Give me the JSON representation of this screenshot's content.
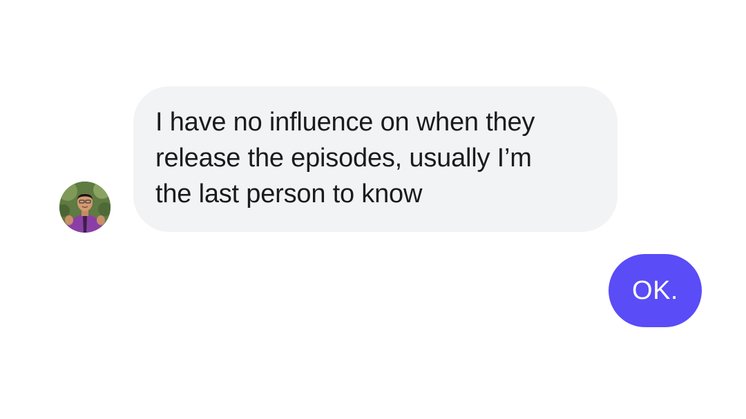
{
  "conversation": {
    "incoming": {
      "lines": [
        "I have no influence on when they",
        "release the episodes, usually I’m",
        "the last person to know"
      ]
    },
    "outgoing": {
      "text": "OK."
    }
  },
  "colors": {
    "incoming_bubble": "#f1f3f5",
    "outgoing_bubble": "#5a4cf6",
    "text_dark": "#1b1b1b",
    "text_light": "#ffffff"
  },
  "icons": {
    "avatar": "user-avatar-photo"
  }
}
